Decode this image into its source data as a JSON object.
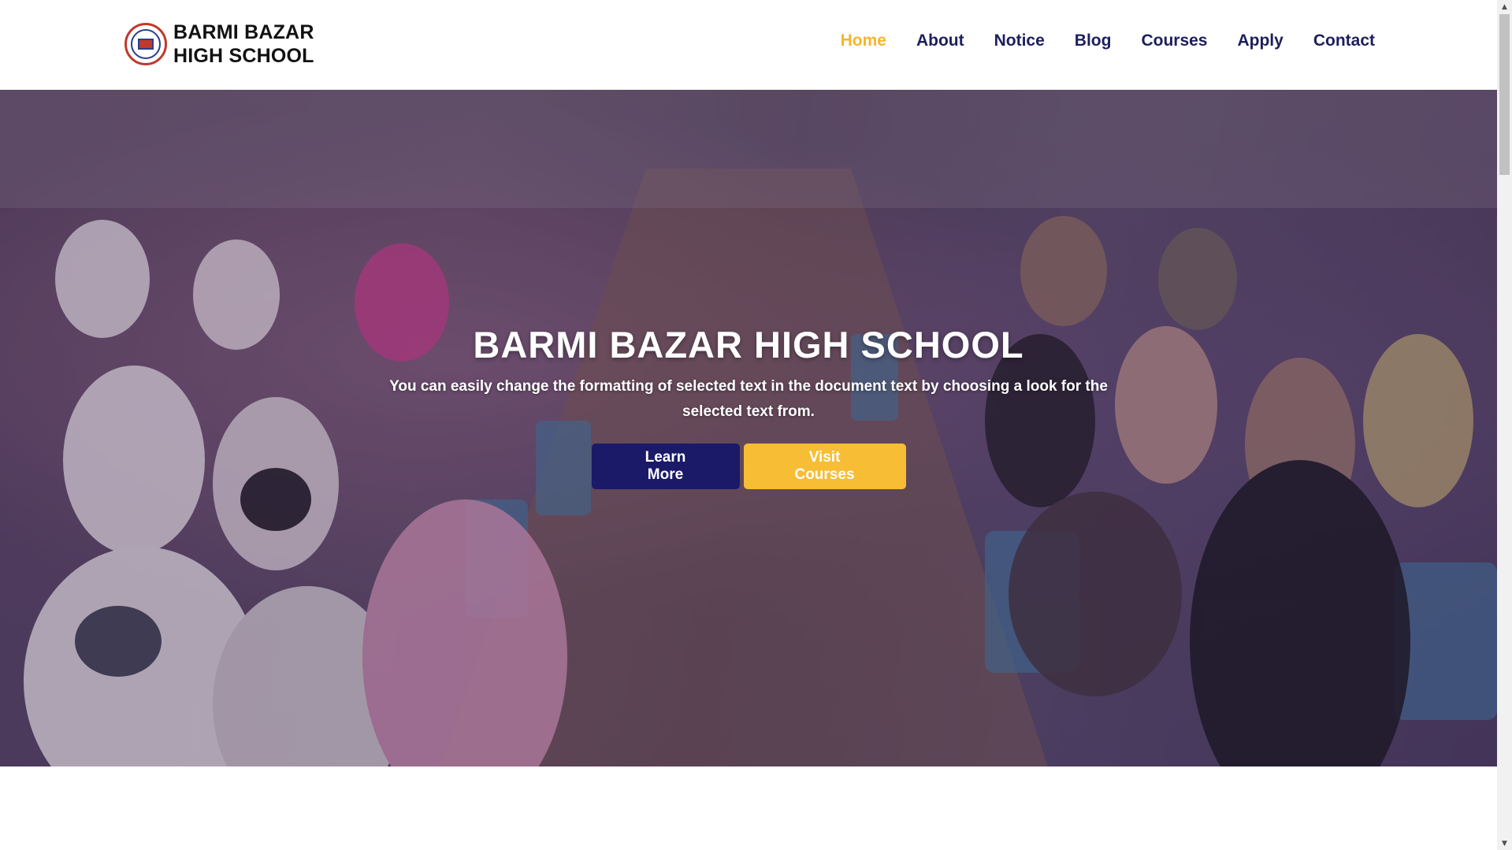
{
  "header": {
    "logo": {
      "line1": "BARMI BAZAR",
      "line2": "HIGH SCHOOL"
    },
    "nav": [
      {
        "label": "Home",
        "active": true
      },
      {
        "label": "About",
        "active": false
      },
      {
        "label": "Notice",
        "active": false
      },
      {
        "label": "Blog",
        "active": false
      },
      {
        "label": "Courses",
        "active": false
      },
      {
        "label": "Apply",
        "active": false
      },
      {
        "label": "Contact",
        "active": false
      }
    ]
  },
  "hero": {
    "title": "BARMI BAZAR HIGH SCHOOL",
    "subtitle": "You can easily change the formatting of selected text in the document text by choosing a look for the selected text from.",
    "buttons": {
      "learn_more": "Learn More",
      "visit_courses": "Visit Courses"
    }
  },
  "colors": {
    "nav_text": "#1c1f5c",
    "nav_active": "#f6b52b",
    "primary_button": "#1b1a68",
    "secondary_button": "#f7bd34"
  },
  "icons": {
    "logo": "school-emblem-icon",
    "scroll_up": "scroll-up-arrow-icon",
    "scroll_down": "scroll-down-arrow-icon"
  }
}
